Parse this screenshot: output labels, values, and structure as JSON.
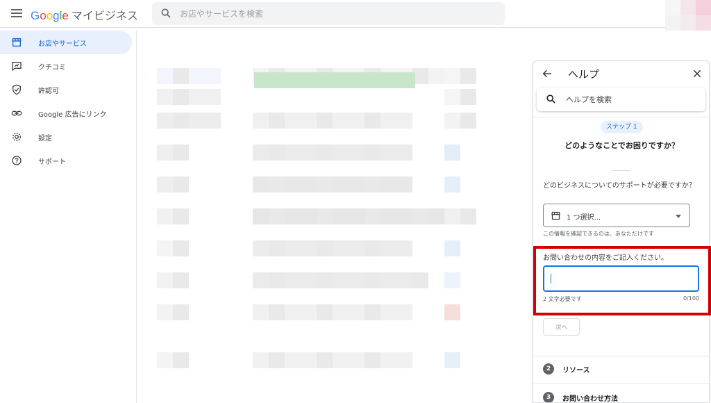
{
  "header": {
    "brand": "Google",
    "product": "マイビジネス",
    "search_placeholder": "お店やサービスを検索"
  },
  "sidebar": {
    "items": [
      {
        "label": "お店やサービス",
        "icon": "storefront-icon",
        "active": true
      },
      {
        "label": "クチコミ",
        "icon": "review-icon",
        "active": false
      },
      {
        "label": "許認可",
        "icon": "verified-shield-icon",
        "active": false
      },
      {
        "label": "Google 広告にリンク",
        "icon": "link-icon",
        "active": false
      },
      {
        "label": "設定",
        "icon": "gear-icon",
        "active": false
      },
      {
        "label": "サポート",
        "icon": "help-circle-icon",
        "active": false
      }
    ]
  },
  "help": {
    "title": "ヘルプ",
    "search_placeholder": "ヘルプを検索",
    "step_chip": "ステップ 1",
    "question": "どのようなことでお困りですか？",
    "business_label": "どのビジネスについてのサポートが必要ですか？",
    "select_value": "1 つ選択...",
    "privacy_note": "この情報を確認できるのは、あなただけです",
    "content_label": "お問い合わせの内容をご記入ください。",
    "content_value": "",
    "hint": "2 文字必要です",
    "counter": "0/100",
    "next_button": "次へ",
    "steps": [
      {
        "num": "2",
        "label": "リソース"
      },
      {
        "num": "3",
        "label": "お問い合わせ方法"
      }
    ]
  },
  "colors": {
    "accent": "#1a73e8",
    "highlight": "#d40000",
    "active_nav_bg": "#e8f0fe"
  }
}
